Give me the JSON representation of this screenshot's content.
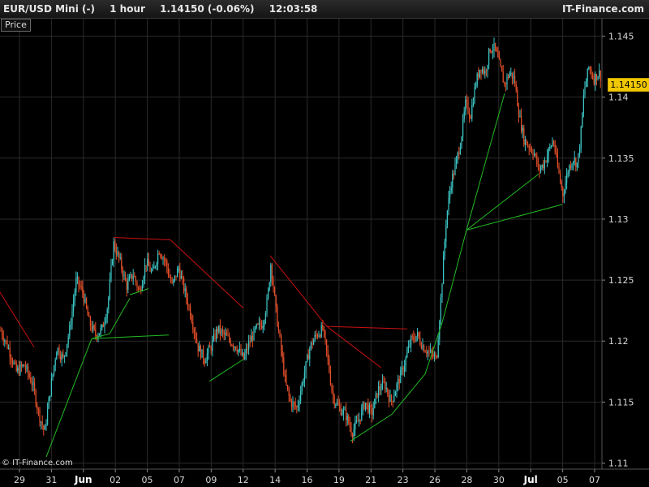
{
  "header": {
    "instrument": "EUR/USD Mini (-)",
    "timeframe": "1 hour",
    "quote": "1.14150 (-0.06%)",
    "time": "12:03:58",
    "brand": "IT-Finance.com"
  },
  "price_tag": "Price",
  "copyright": "© IT-Finance.com",
  "current_price": "1.14150",
  "colors": {
    "up": "#3ec7c7",
    "down": "#e8502a",
    "support": "#22bb22",
    "resistance": "#cc1111",
    "grid": "#2a2a2a",
    "background": "#000000",
    "price_tag_bg": "#f0c800"
  },
  "chart_data": {
    "type": "candlestick",
    "y_ticks": [
      "1.11",
      "1.115",
      "1.12",
      "1.125",
      "1.13",
      "1.135",
      "1.14",
      "1.145"
    ],
    "ylim": [
      1.1095,
      1.1465
    ],
    "x_ticks": [
      {
        "label": "29",
        "bold": false
      },
      {
        "label": "31",
        "bold": false
      },
      {
        "label": "Jun",
        "bold": true
      },
      {
        "label": "02",
        "bold": false
      },
      {
        "label": "05",
        "bold": false
      },
      {
        "label": "07",
        "bold": false
      },
      {
        "label": "09",
        "bold": false
      },
      {
        "label": "12",
        "bold": false
      },
      {
        "label": "14",
        "bold": false
      },
      {
        "label": "16",
        "bold": false
      },
      {
        "label": "19",
        "bold": false
      },
      {
        "label": "21",
        "bold": false
      },
      {
        "label": "23",
        "bold": false
      },
      {
        "label": "26",
        "bold": false
      },
      {
        "label": "28",
        "bold": false
      },
      {
        "label": "30",
        "bold": false
      },
      {
        "label": "Jul",
        "bold": true
      },
      {
        "label": "05",
        "bold": false
      },
      {
        "label": "07",
        "bold": false
      }
    ],
    "price_path": [
      [
        0,
        1.121
      ],
      [
        10,
        1.1195
      ],
      [
        20,
        1.1175
      ],
      [
        30,
        1.118
      ],
      [
        40,
        1.1165
      ],
      [
        48,
        1.114
      ],
      [
        55,
        1.1125
      ],
      [
        62,
        1.116
      ],
      [
        70,
        1.1195
      ],
      [
        78,
        1.1185
      ],
      [
        86,
        1.121
      ],
      [
        94,
        1.125
      ],
      [
        102,
        1.124
      ],
      [
        110,
        1.1215
      ],
      [
        118,
        1.1205
      ],
      [
        126,
        1.121
      ],
      [
        133,
        1.123
      ],
      [
        140,
        1.128
      ],
      [
        148,
        1.1265
      ],
      [
        156,
        1.1245
      ],
      [
        164,
        1.1255
      ],
      [
        172,
        1.124
      ],
      [
        180,
        1.1265
      ],
      [
        188,
        1.1255
      ],
      [
        196,
        1.1275
      ],
      [
        204,
        1.1265
      ],
      [
        212,
        1.1245
      ],
      [
        220,
        1.126
      ],
      [
        228,
        1.124
      ],
      [
        236,
        1.122
      ],
      [
        244,
        1.1195
      ],
      [
        252,
        1.1185
      ],
      [
        260,
        1.1195
      ],
      [
        268,
        1.121
      ],
      [
        276,
        1.1205
      ],
      [
        284,
        1.12
      ],
      [
        292,
        1.1195
      ],
      [
        300,
        1.1185
      ],
      [
        308,
        1.12
      ],
      [
        316,
        1.121
      ],
      [
        324,
        1.1215
      ],
      [
        330,
        1.1235
      ],
      [
        334,
        1.1265
      ],
      [
        340,
        1.1225
      ],
      [
        346,
        1.1195
      ],
      [
        352,
        1.1165
      ],
      [
        358,
        1.115
      ],
      [
        366,
        1.1145
      ],
      [
        374,
        1.117
      ],
      [
        382,
        1.1195
      ],
      [
        390,
        1.1205
      ],
      [
        398,
        1.121
      ],
      [
        404,
        1.1185
      ],
      [
        410,
        1.1155
      ],
      [
        418,
        1.1145
      ],
      [
        426,
        1.114
      ],
      [
        434,
        1.1125
      ],
      [
        442,
        1.1135
      ],
      [
        450,
        1.115
      ],
      [
        458,
        1.114
      ],
      [
        466,
        1.116
      ],
      [
        474,
        1.1165
      ],
      [
        482,
        1.115
      ],
      [
        490,
        1.1165
      ],
      [
        498,
        1.118
      ],
      [
        506,
        1.12
      ],
      [
        514,
        1.1205
      ],
      [
        522,
        1.1195
      ],
      [
        530,
        1.119
      ],
      [
        538,
        1.1185
      ],
      [
        544,
        1.124
      ],
      [
        550,
        1.13
      ],
      [
        556,
        1.133
      ],
      [
        562,
        1.1345
      ],
      [
        568,
        1.1365
      ],
      [
        574,
        1.1395
      ],
      [
        580,
        1.1385
      ],
      [
        586,
        1.141
      ],
      [
        592,
        1.1425
      ],
      [
        598,
        1.142
      ],
      [
        604,
        1.144
      ],
      [
        610,
        1.144
      ],
      [
        616,
        1.1425
      ],
      [
        622,
        1.141
      ],
      [
        628,
        1.142
      ],
      [
        634,
        1.1415
      ],
      [
        640,
        1.1385
      ],
      [
        646,
        1.1365
      ],
      [
        652,
        1.136
      ],
      [
        658,
        1.1355
      ],
      [
        664,
        1.134
      ],
      [
        670,
        1.1345
      ],
      [
        676,
        1.1355
      ],
      [
        682,
        1.1365
      ],
      [
        688,
        1.134
      ],
      [
        694,
        1.132
      ],
      [
        700,
        1.134
      ],
      [
        706,
        1.135
      ],
      [
        712,
        1.1345
      ],
      [
        716,
        1.137
      ],
      [
        720,
        1.1405
      ],
      [
        726,
        1.1425
      ],
      [
        732,
        1.1415
      ],
      [
        738,
        1.142
      ],
      [
        742,
        1.1415
      ]
    ],
    "support_lines": [
      [
        [
          57,
          1.1105
        ],
        [
          113,
          1.1202
        ]
      ],
      [
        [
          113,
          1.1202
        ],
        [
          208,
          1.1205
        ]
      ],
      [
        [
          113,
          1.1202
        ],
        [
          135,
          1.1206
        ]
      ],
      [
        [
          135,
          1.1206
        ],
        [
          160,
          1.1235
        ]
      ],
      [
        [
          160,
          1.1238
        ],
        [
          183,
          1.1243
        ]
      ],
      [
        [
          258,
          1.1167
        ],
        [
          300,
          1.1185
        ]
      ],
      [
        [
          432,
          1.1118
        ],
        [
          483,
          1.114
        ]
      ],
      [
        [
          483,
          1.114
        ],
        [
          524,
          1.1173
        ]
      ],
      [
        [
          524,
          1.1173
        ],
        [
          545,
          1.1215
        ]
      ],
      [
        [
          545,
          1.1215
        ],
        [
          575,
          1.1291
        ]
      ],
      [
        [
          575,
          1.1291
        ],
        [
          622,
          1.1403
        ]
      ],
      [
        [
          575,
          1.1291
        ],
        [
          664,
          1.1337
        ]
      ],
      [
        [
          575,
          1.1291
        ],
        [
          693,
          1.1312
        ]
      ]
    ],
    "resistance_lines": [
      [
        [
          0,
          1.124
        ],
        [
          42,
          1.1195
        ]
      ],
      [
        [
          140,
          1.1285
        ],
        [
          210,
          1.1283
        ]
      ],
      [
        [
          210,
          1.1283
        ],
        [
          300,
          1.1227
        ]
      ],
      [
        [
          333,
          1.127
        ],
        [
          403,
          1.1212
        ]
      ],
      [
        [
          403,
          1.1212
        ],
        [
          502,
          1.121
        ]
      ],
      [
        [
          403,
          1.1212
        ],
        [
          470,
          1.1178
        ]
      ]
    ]
  }
}
